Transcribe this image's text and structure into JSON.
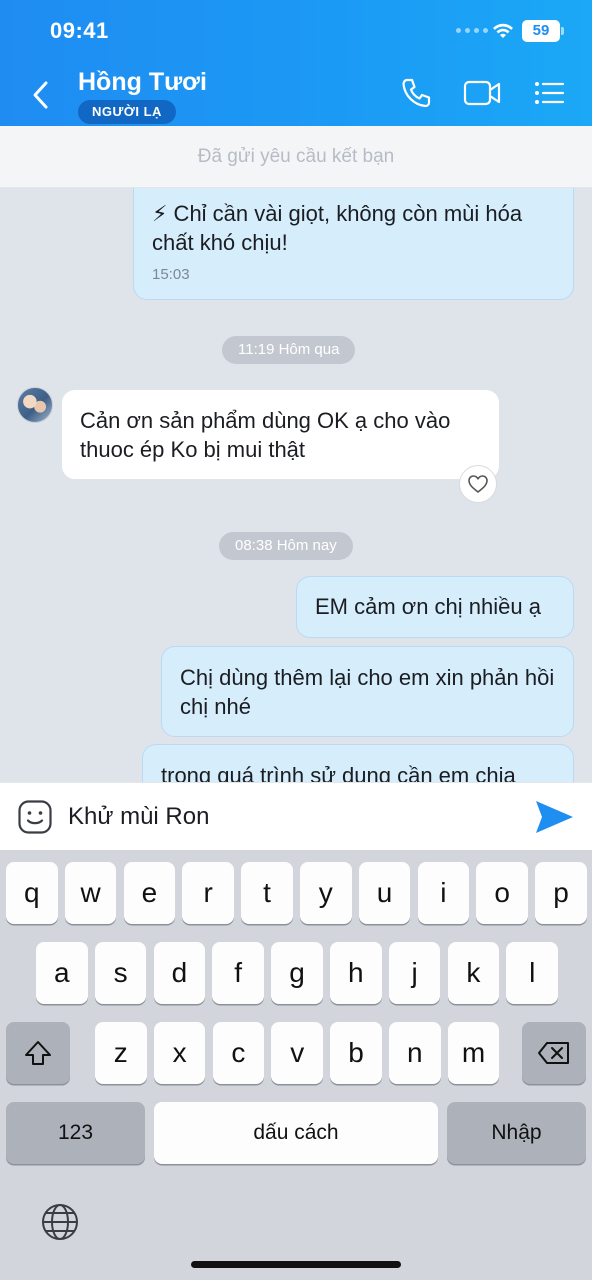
{
  "status_bar": {
    "time": "09:41",
    "battery": "59"
  },
  "header": {
    "name": "Hồng Tươi",
    "badge": "NGƯỜI LẠ"
  },
  "request_bar": {
    "text": "Đã gửi yêu cầu kết bạn"
  },
  "messages": {
    "m1": {
      "text": "⚡ Chỉ cần vài giọt, không còn mùi hóa chất khó chịu!",
      "time": "15:03"
    },
    "sep1": "11:19 Hôm qua",
    "m2": {
      "text": "Cản ơn sản phẩm dùng OK ạ cho vào thuoc ép Ko bị mui  thật"
    },
    "sep2": "08:38 Hôm nay",
    "m3": {
      "text": "EM cảm ơn chị nhiều ạ"
    },
    "m4": {
      "text": "Chị dùng thêm lại cho em xin phản hồi chị nhé"
    },
    "m5": {
      "text": "trong quá trình sử dụng cần em chia"
    }
  },
  "input": {
    "value": "Khử mùi Ron"
  },
  "keyboard": {
    "row1": [
      "q",
      "w",
      "e",
      "r",
      "t",
      "y",
      "u",
      "i",
      "o",
      "p"
    ],
    "row2": [
      "a",
      "s",
      "d",
      "f",
      "g",
      "h",
      "j",
      "k",
      "l"
    ],
    "row3": [
      "z",
      "x",
      "c",
      "v",
      "b",
      "n",
      "m"
    ],
    "numbers_label": "123",
    "space_label": "dấu cách",
    "return_label": "Nhập"
  },
  "colors": {
    "header": "#1b9bf5",
    "outgoing_bubble": "#d6edfb",
    "send": "#1f8ef1"
  }
}
